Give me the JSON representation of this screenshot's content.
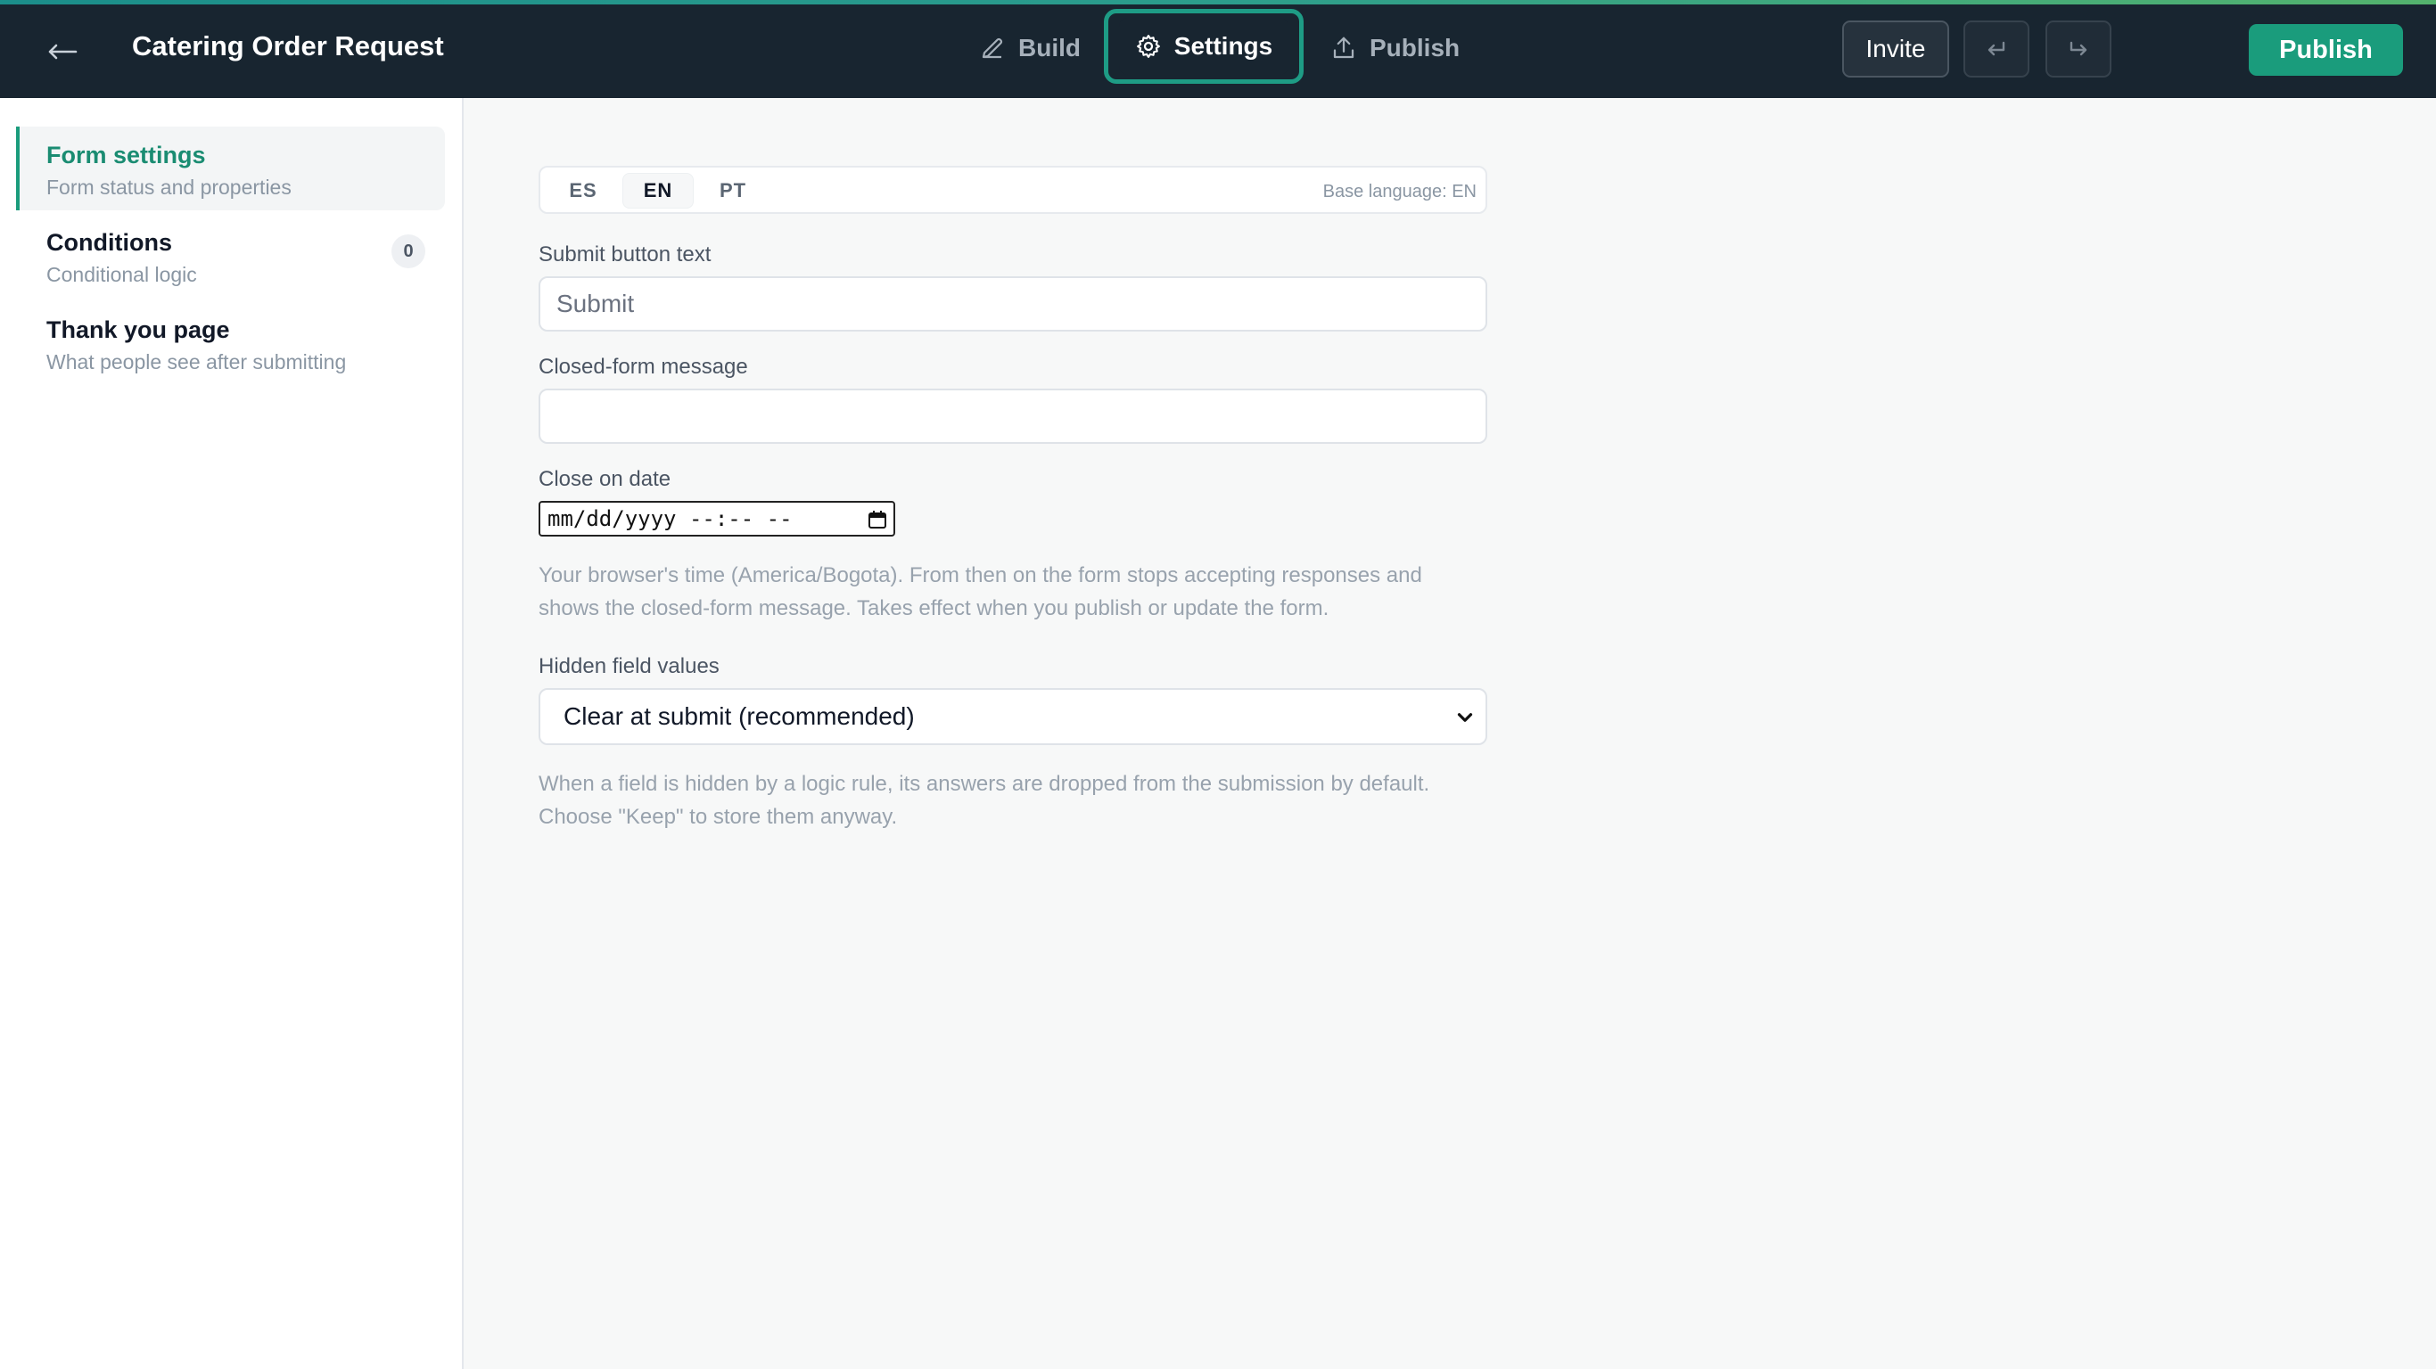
{
  "header": {
    "back_label": "←",
    "form_title": "Catering Order Request",
    "tabs": [
      {
        "label": "Build",
        "icon": "pencil-icon"
      },
      {
        "label": "Settings",
        "icon": "gear-icon",
        "active": true
      },
      {
        "label": "Publish",
        "icon": "upload-icon"
      }
    ],
    "invite_label": "Invite",
    "publish_label": "Publish",
    "colors": {
      "bar": "#182530",
      "accent": "#1a9c7c"
    }
  },
  "sidebar": {
    "items": [
      {
        "label": "Form settings",
        "desc": "Form status and properties",
        "active": true
      },
      {
        "label": "Conditions",
        "desc": "Conditional logic",
        "count": "0"
      },
      {
        "label": "Thank you page",
        "desc": "What people see after submitting"
      }
    ]
  },
  "languages": {
    "tabs": [
      "ES",
      "EN",
      "PT"
    ],
    "selected": "EN",
    "base_language": "Base language: EN"
  },
  "form": {
    "submit_text_label": "Submit button text",
    "submit_text_placeholder": "Submit",
    "closed_message_label": "Closed-form message",
    "closed_message_value": "",
    "close_date_label": "Close on date",
    "close_date_value": "mm/dd/yyyy --:-- --",
    "close_date_help": "Your browser's time (America/Bogota). From then on the form stops accepting responses and shows the closed-form message. Takes effect when you publish or update the form.",
    "hidden_values_label": "Hidden field values",
    "hidden_values_selected": "Clear at submit (recommended)",
    "hidden_values_help": "When a field is hidden by a logic rule, its answers are dropped from the submission by default. Choose \"Keep\" to store them anyway."
  }
}
